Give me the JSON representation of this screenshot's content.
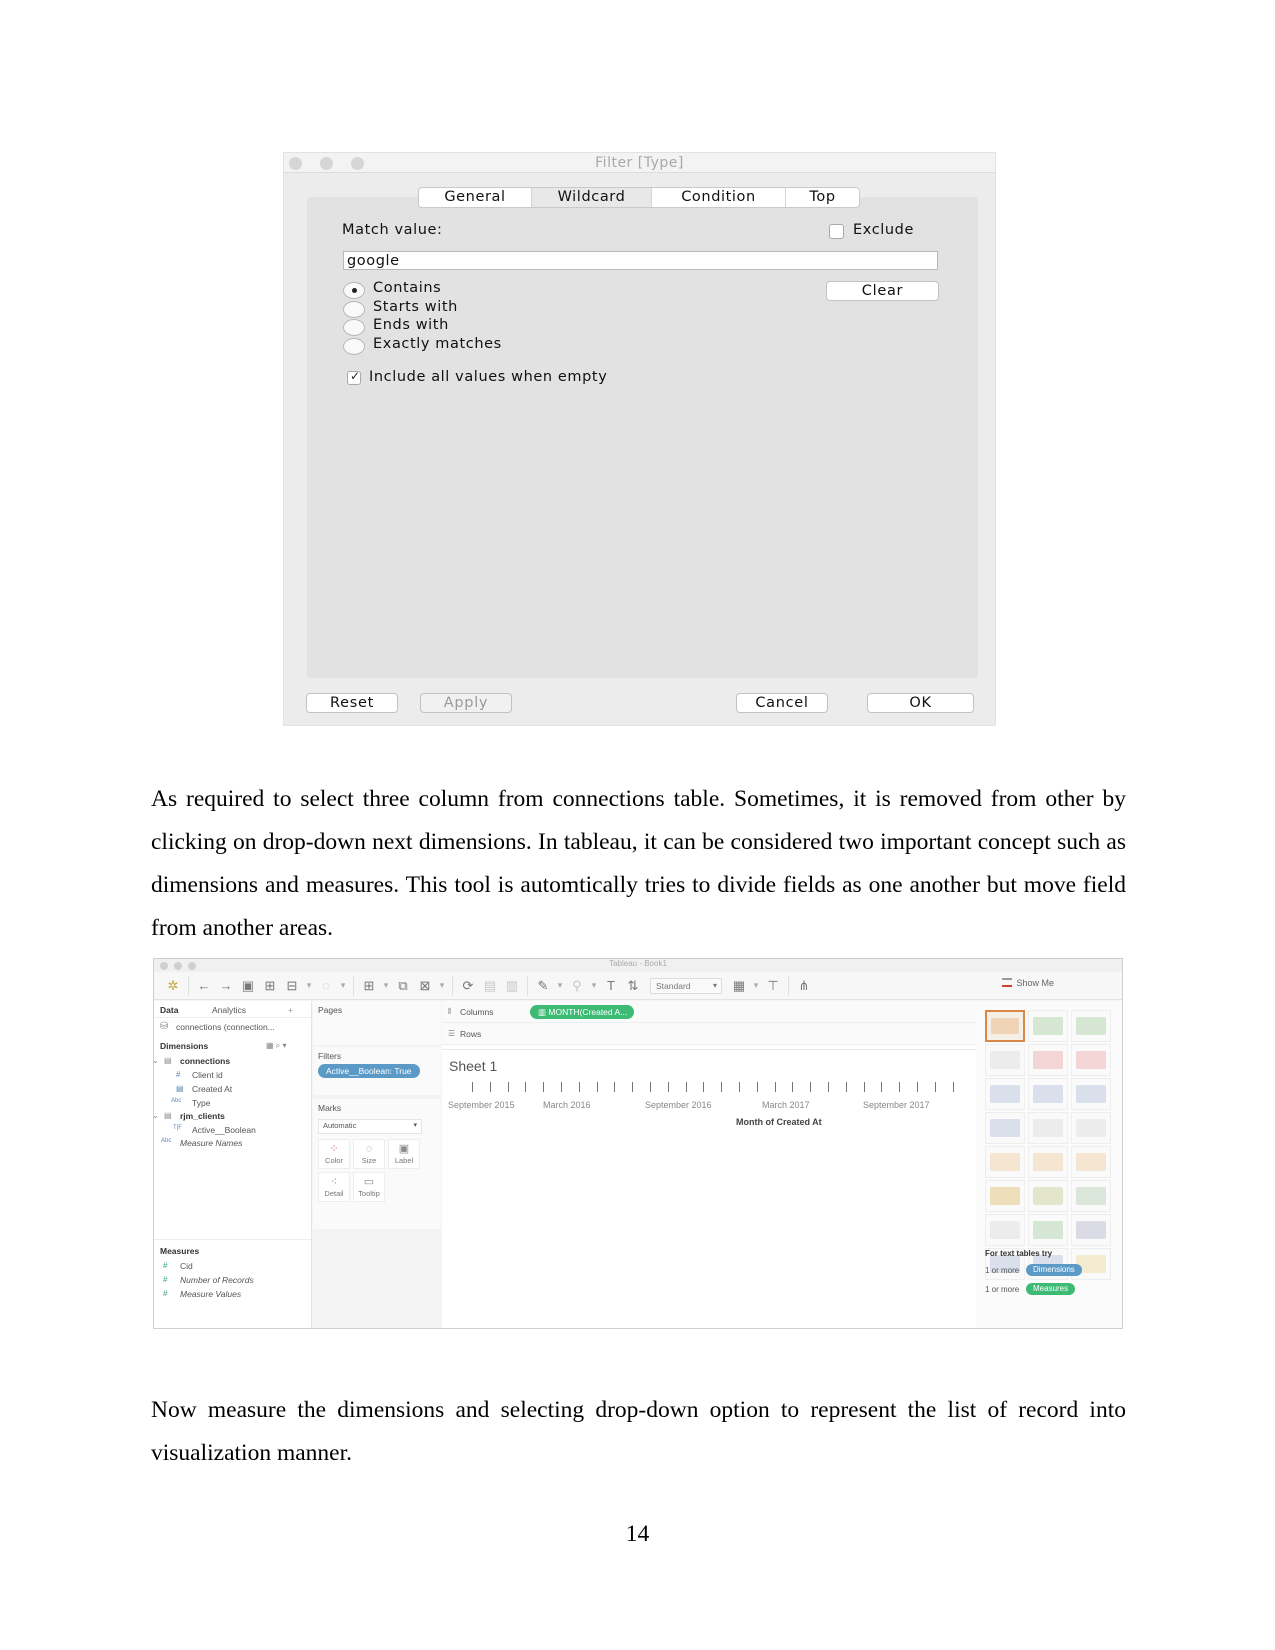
{
  "filter_dialog": {
    "title": "Filter [Type]",
    "tabs": [
      {
        "label": "General",
        "active": false
      },
      {
        "label": "Wildcard",
        "active": true
      },
      {
        "label": "Condition",
        "active": false
      },
      {
        "label": "Top",
        "active": false
      }
    ],
    "match_value_label": "Match value:",
    "match_value": "google",
    "exclude_label": "Exclude",
    "exclude_checked": false,
    "clear_label": "Clear",
    "match_options": [
      {
        "label": "Contains",
        "selected": true
      },
      {
        "label": "Starts with",
        "selected": false
      },
      {
        "label": "Ends with",
        "selected": false
      },
      {
        "label": "Exactly matches",
        "selected": false
      }
    ],
    "include_all_label": "Include all values when empty",
    "include_all_checked": true,
    "buttons": {
      "reset": "Reset",
      "apply": "Apply",
      "cancel": "Cancel",
      "ok": "OK"
    }
  },
  "paragraph1": "As required to select three column from connections table. Sometimes, it is removed from other by clicking on drop-down next dimensions. In tableau, it can be considered two important concept such as dimensions and measures. This tool is automtically tries to divide fields as one another but move field from another areas.",
  "tableau": {
    "window_title": "Tableau - Book1",
    "toolbar": {
      "fit_select": "Standard",
      "show_me": "Show Me"
    },
    "left_panel": {
      "tabs": [
        "Data",
        "Analytics"
      ],
      "datasource": "connections (connection...",
      "dimensions_header": "Dimensions",
      "tables": [
        {
          "name": "connections",
          "fields": [
            {
              "icon": "#",
              "name": "Client id"
            },
            {
              "icon": "date",
              "name": "Created At"
            },
            {
              "icon": "Abc",
              "name": "Type"
            }
          ]
        },
        {
          "name": "rjm_clients",
          "fields": [
            {
              "icon": "T|F",
              "name": "Active__Boolean"
            }
          ]
        }
      ],
      "measure_names": "Measure Names",
      "measures_header": "Measures",
      "measures": [
        "Cid",
        "Number of Records",
        "Measure Values"
      ]
    },
    "mid_panel": {
      "pages_label": "Pages",
      "filters_label": "Filters",
      "filter_pill": "Active__Boolean: True",
      "marks_label": "Marks",
      "mark_type": "Automatic",
      "mark_buttons": [
        "Color",
        "Size",
        "Label",
        "Detail",
        "Tooltip"
      ]
    },
    "shelves": {
      "columns_label": "Columns",
      "columns_pill": "MONTH(Created A...",
      "rows_label": "Rows"
    },
    "sheet": {
      "title": "Sheet 1",
      "axis_labels": [
        "September 2015",
        "March 2016",
        "September 2016",
        "March 2017",
        "September 2017"
      ],
      "axis_title": "Month of Created At",
      "tick_count": 28
    },
    "show_me": {
      "hint_title": "For text tables try",
      "hint_prefix": "1 or more",
      "dimensions_pill": "Dimensions",
      "measures_pill": "Measures"
    }
  },
  "paragraph2": "Now measure the dimensions and selecting drop-down option to represent the list of record into visualization manner.",
  "page_number": "14"
}
